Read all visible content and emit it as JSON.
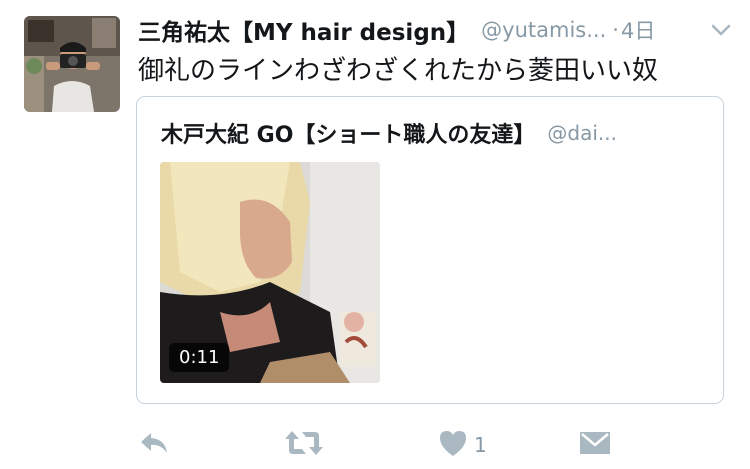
{
  "tweet": {
    "display_name": "三角祐太【MY hair design】",
    "handle": "@yutamis...",
    "dot": "·",
    "time": "4日",
    "text": "御礼のラインわざわざくれたから菱田いい奴"
  },
  "quoted_tweet": {
    "display_name": "木戸大紀 GO【ショート職人の友達】",
    "handle": "@dai...",
    "video_duration": "0:11"
  },
  "actions": {
    "like_count": "1"
  },
  "icons": {
    "reply": "reply-icon",
    "retweet": "retweet-icon",
    "like": "heart-icon",
    "dm": "direct-message-icon",
    "caret": "chevron-down-icon"
  },
  "colors": {
    "text": "#14171a",
    "secondary": "#8899a6",
    "border": "#c8d3dc",
    "icon": "#aab8c2"
  }
}
